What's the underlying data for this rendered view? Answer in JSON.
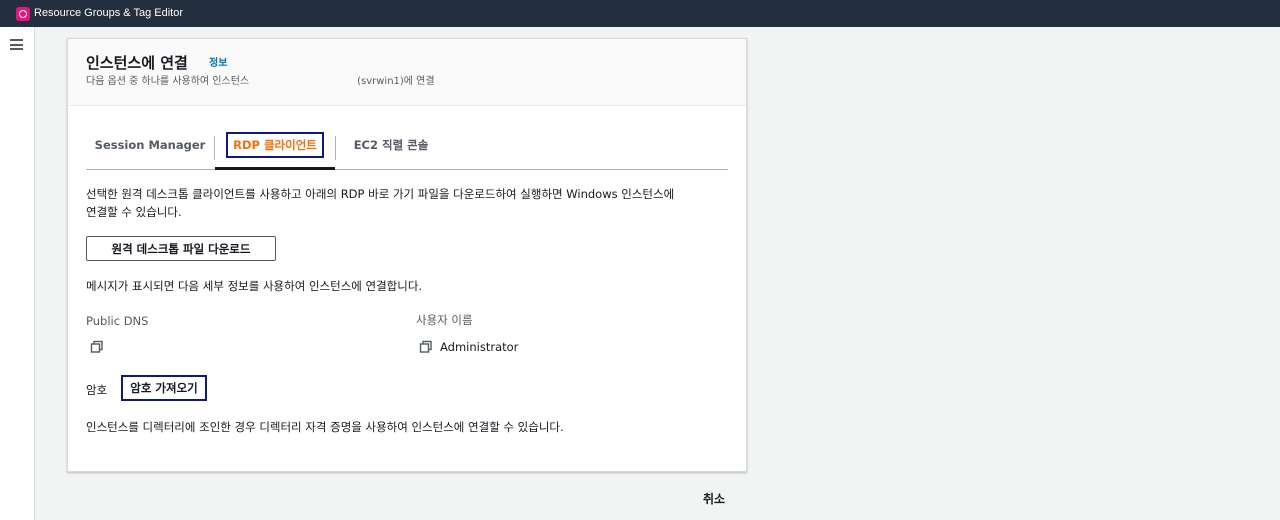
{
  "topbar": {
    "app_title": "Resource Groups & Tag Editor",
    "icon": "resource-groups-icon"
  },
  "sidebar": {
    "menu_icon": "hamburger-menu-icon"
  },
  "panel": {
    "title": "인스턴스에 연결",
    "info_link": "정보",
    "desc_prefix": "다음 옵션 중 하나를 사용하여 인스턴스",
    "desc_suffix": "(svrwin1)에 연결"
  },
  "tabs": [
    {
      "label": "Session Manager",
      "active": false
    },
    {
      "label": "RDP 클라이언트",
      "active": true
    },
    {
      "label": "EC2 직렬 콘솔",
      "active": false
    }
  ],
  "rdp": {
    "intro_line1": "선택한 원격 데스크톱 클라이언트를 사용하고 아래의 RDP 바로 가기 파일을 다운로드하여 실행하면 Windows 인스턴스에",
    "intro_line2": "연결할 수 있습니다.",
    "download_button": "원격 데스크톱 파일 다운로드",
    "prompt_text": "메시지가 표시되면 다음 세부 정보를 사용하여 인스턴스에 연결합니다.",
    "public_dns_label": "Public DNS",
    "public_dns_value": "",
    "username_label": "사용자 이름",
    "username_value": "Administrator",
    "password_label": "암호",
    "get_password_button": "암호 가져오기",
    "directory_text": "인스턴스를 디렉터리에 조인한 경우 디렉터리 자격 증명을 사용하여 인스턴스에 연결할 수 있습니다."
  },
  "footer": {
    "cancel": "취소"
  },
  "colors": {
    "accent_orange": "#ec7211",
    "link_blue": "#0073bb",
    "focus_navy": "#0f1b7a",
    "topbar": "#232f3e"
  }
}
